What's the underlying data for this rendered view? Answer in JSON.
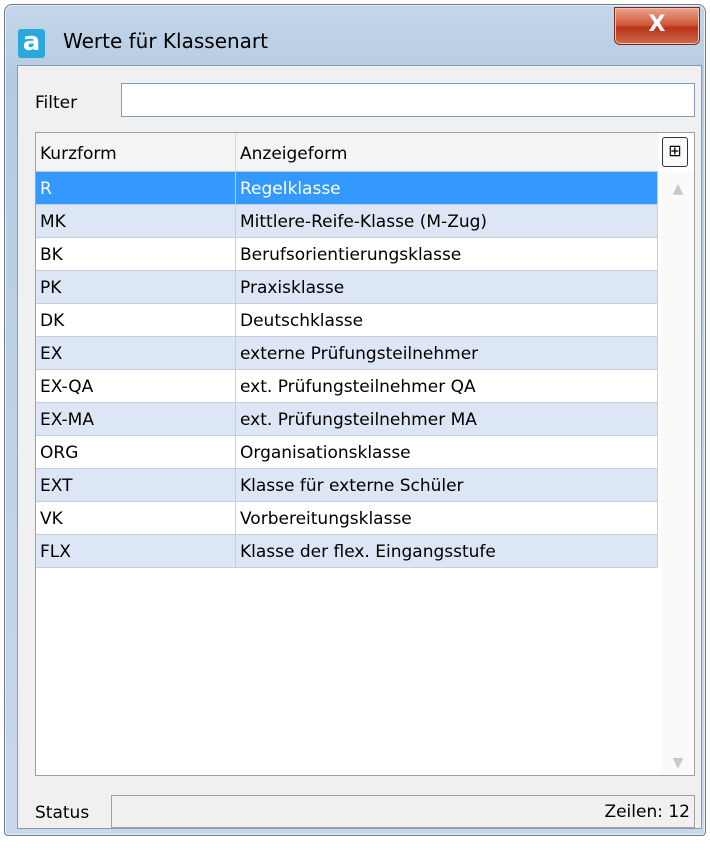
{
  "window": {
    "title": "Werte für Klassenart",
    "app_icon_glyph": "a",
    "close_glyph": "X"
  },
  "filter": {
    "label": "Filter",
    "value": ""
  },
  "grid": {
    "columns": [
      "Kurzform",
      "Anzeigeform"
    ],
    "column_chooser_glyph": "⊞",
    "selected_row": 0,
    "rows": [
      {
        "kurzform": "R",
        "anzeigeform": "Regelklasse"
      },
      {
        "kurzform": "MK",
        "anzeigeform": "Mittlere-Reife-Klasse (M-Zug)"
      },
      {
        "kurzform": "BK",
        "anzeigeform": "Berufsorientierungsklasse"
      },
      {
        "kurzform": "PK",
        "anzeigeform": "Praxisklasse"
      },
      {
        "kurzform": "DK",
        "anzeigeform": "Deutschklasse"
      },
      {
        "kurzform": "EX",
        "anzeigeform": "externe Prüfungsteilnehmer"
      },
      {
        "kurzform": "EX-QA",
        "anzeigeform": "ext. Prüfungsteilnehmer QA"
      },
      {
        "kurzform": "EX-MA",
        "anzeigeform": "ext. Prüfungsteilnehmer MA"
      },
      {
        "kurzform": "ORG",
        "anzeigeform": "Organisationsklasse"
      },
      {
        "kurzform": "EXT",
        "anzeigeform": "Klasse für externe Schüler"
      },
      {
        "kurzform": "VK",
        "anzeigeform": "Vorbereitungsklasse"
      },
      {
        "kurzform": "FLX",
        "anzeigeform": "Klasse der flex. Eingangsstufe"
      }
    ]
  },
  "status": {
    "label": "Status",
    "rows_text": "Zeilen: 12"
  },
  "colors": {
    "selection": "#3399ff",
    "alt_row": "#dce6f4",
    "close_button": "#c9482a",
    "app_icon": "#2aa8dd"
  }
}
